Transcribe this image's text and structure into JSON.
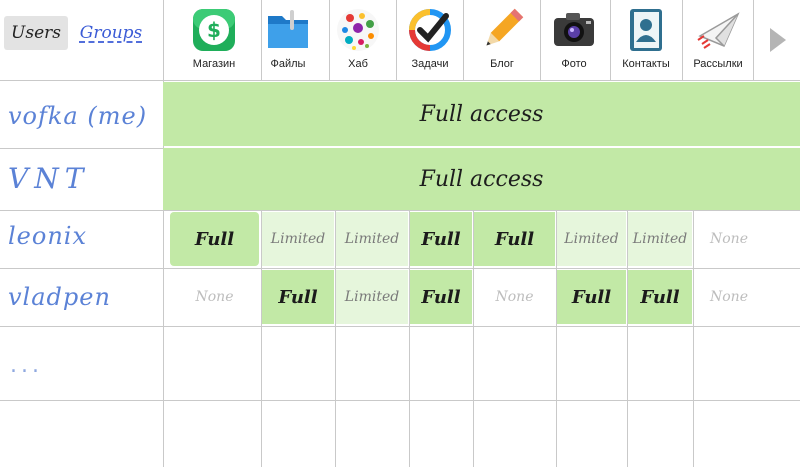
{
  "tabs": {
    "users": "Users",
    "groups": "Groups"
  },
  "apps": [
    {
      "label": "Магазин",
      "icon": "dollar-store-icon"
    },
    {
      "label": "Файлы",
      "icon": "folder-icon"
    },
    {
      "label": "Хаб",
      "icon": "colorful-dots-icon"
    },
    {
      "label": "Задачи",
      "icon": "checkmark-circle-icon"
    },
    {
      "label": "Блог",
      "icon": "pencil-icon"
    },
    {
      "label": "Фото",
      "icon": "camera-icon"
    },
    {
      "label": "Контакты",
      "icon": "contacts-book-icon"
    },
    {
      "label": "Рассылки",
      "icon": "paper-plane-icon"
    }
  ],
  "users": [
    {
      "name": "vofka (me)",
      "access": "Full access"
    },
    {
      "name": "VNT",
      "access": "Full access"
    },
    {
      "name": "leonix",
      "perms": [
        "Full",
        "Limited",
        "Limited",
        "Full",
        "Full",
        "Limited",
        "Limited",
        "None"
      ]
    },
    {
      "name": "vladpen",
      "perms": [
        "None",
        "Full",
        "Limited",
        "Full",
        "None",
        "Full",
        "Full",
        "None"
      ]
    }
  ],
  "more": "...",
  "colors": {
    "full": "#c2e9a6",
    "limited": "#e6f6dc",
    "user_link": "#5b82d6",
    "groups_link": "#3b5bd6"
  }
}
